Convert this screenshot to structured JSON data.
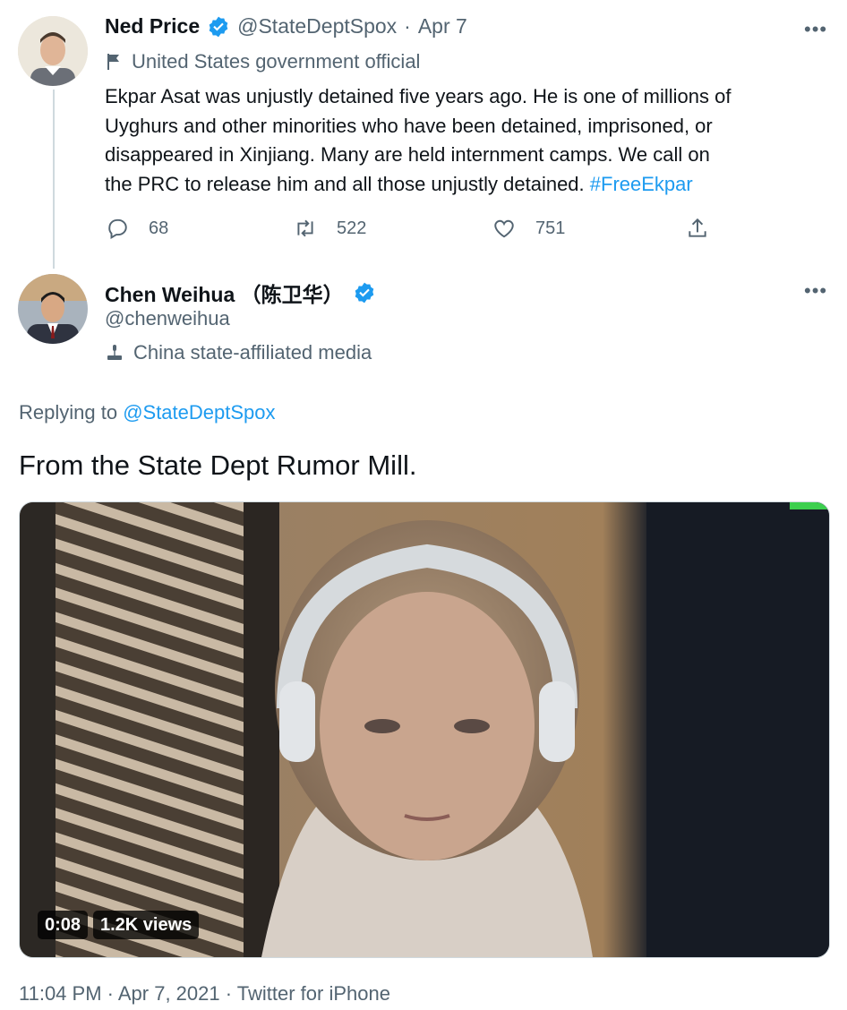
{
  "quoted": {
    "name": "Ned Price",
    "handle": "@StateDeptSpox",
    "separator": "·",
    "date": "Apr 7",
    "label": "United States government official",
    "text_lines": [
      "Ekpar Asat was unjustly detained five years ago. He is one of millions of",
      "Uyghurs and other minorities who have been detained, imprisoned, or",
      "disappeared in Xinjiang. Many are held internment camps. We call on",
      "the PRC to release him and all those unjustly detained. "
    ],
    "hashtag": "#FreeEkpar",
    "replies": "68",
    "retweets": "522",
    "likes": "751"
  },
  "tweet": {
    "name": "Chen Weihua （陈卫华）",
    "handle": "@chenweihua",
    "label": "China state-affiliated media",
    "replying_prefix": "Replying to ",
    "replying_to": "@StateDeptSpox",
    "text": "From the State Dept Rumor Mill.",
    "video_time": "0:08",
    "video_views": "1.2K views",
    "footer": "11:04 PM · Apr 7, 2021 · Twitter for iPhone"
  },
  "ui": {
    "more": "•••"
  },
  "colors": {
    "accent": "#1d9bf0",
    "muted": "#536471",
    "text": "#0f1419"
  }
}
